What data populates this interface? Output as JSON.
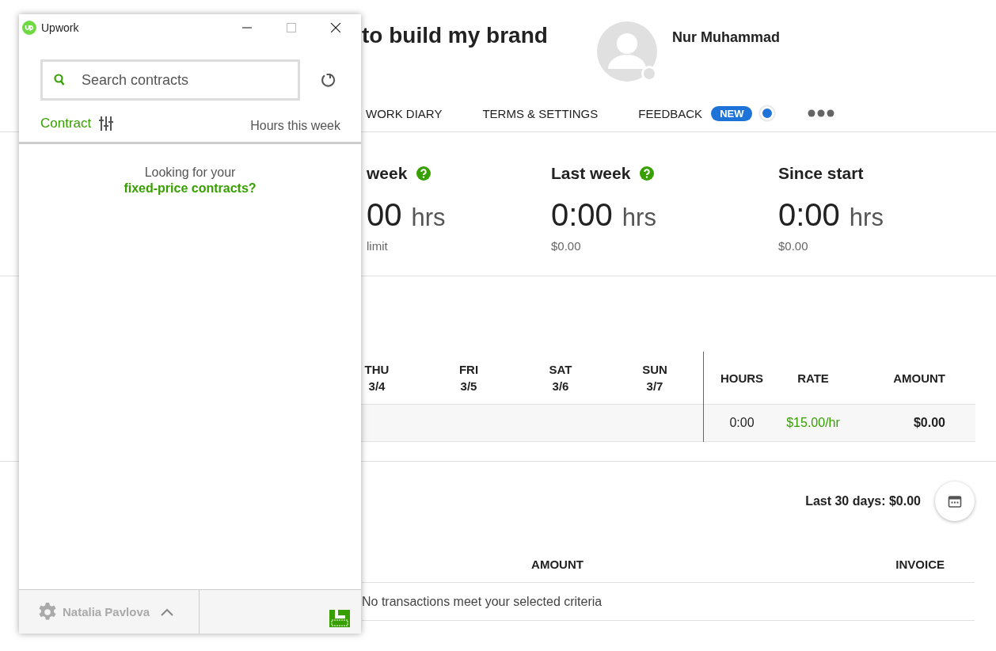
{
  "page": {
    "title_fragment": "to build my brand",
    "user": {
      "name": "Nur Muhammad"
    },
    "nav": [
      {
        "label": "WORK DIARY"
      },
      {
        "label": "TERMS & SETTINGS"
      },
      {
        "label": "FEEDBACK",
        "badge": "NEW"
      }
    ],
    "stats": [
      {
        "heading": "week",
        "help": true,
        "value": "00",
        "unit": "hrs",
        "sub": "limit"
      },
      {
        "heading": "Last week",
        "help": true,
        "value": "0:00",
        "unit": "hrs",
        "sub": "$0.00"
      },
      {
        "heading": "Since start",
        "help": false,
        "value": "0:00",
        "unit": "hrs",
        "sub": "$0.00"
      }
    ],
    "timesheet": {
      "days": [
        {
          "day": "THU",
          "date": "3/4"
        },
        {
          "day": "FRI",
          "date": "3/5"
        },
        {
          "day": "SAT",
          "date": "3/6"
        },
        {
          "day": "SUN",
          "date": "3/7"
        }
      ],
      "total_columns": [
        "HOURS",
        "RATE",
        "AMOUNT"
      ],
      "row": {
        "hours": "0:00",
        "rate": "$15.00/hr",
        "amount": "$0.00"
      }
    },
    "earnings": {
      "summary": "Last 30 days: $0.00",
      "columns": [
        "AMOUNT",
        "INVOICE"
      ],
      "empty": "No transactions meet your selected criteria"
    }
  },
  "window": {
    "title": "Upwork",
    "search": {
      "placeholder": "Search contracts"
    },
    "columns": {
      "contract": "Contract",
      "hours": "Hours this week"
    },
    "empty_prompt": "Looking for your",
    "empty_link": "fixed-price contracts?",
    "footer": {
      "user": "Natalia Pavlova"
    }
  }
}
